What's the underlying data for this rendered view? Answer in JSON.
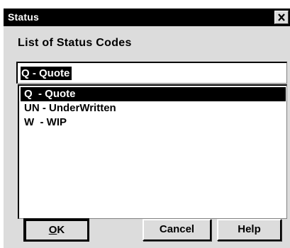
{
  "window": {
    "title": "Status",
    "close_icon": "close-icon"
  },
  "dialog": {
    "caption": "List of Status Codes",
    "field_value": "Q  - Quote",
    "list": {
      "items": [
        {
          "label": "Q  - Quote",
          "selected": true
        },
        {
          "label": "UN - UnderWritten",
          "selected": false
        },
        {
          "label": "W  - WIP",
          "selected": false
        }
      ]
    }
  },
  "buttons": {
    "ok_mnemonic": "O",
    "ok_rest": "K",
    "cancel": "Cancel",
    "help": "Help"
  },
  "colors": {
    "titlebar": "#000000",
    "dialog_bg": "#dcdcdc",
    "selection": "#000000"
  }
}
